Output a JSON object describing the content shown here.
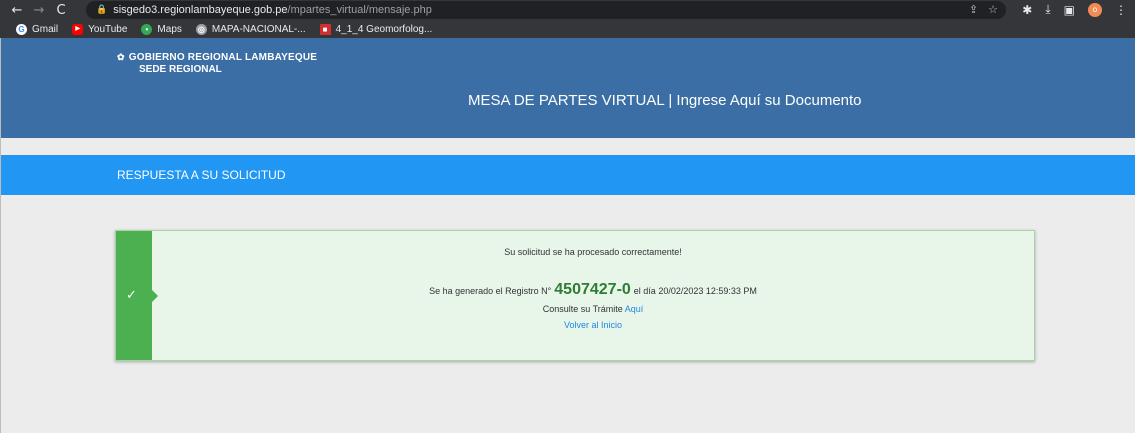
{
  "browser": {
    "url_host": "sisgedo3.regionlambayeque.gob.pe",
    "url_path": "/mpartes_virtual/mensaje.php",
    "profile_initial": "o",
    "bookmarks": [
      {
        "label": "Gmail"
      },
      {
        "label": "YouTube"
      },
      {
        "label": "Maps"
      },
      {
        "label": "MAPA-NACIONAL-..."
      },
      {
        "label": "4_1_4 Geomorfolog..."
      }
    ]
  },
  "header": {
    "org_name": "GOBIERNO REGIONAL LAMBAYEQUE",
    "org_sub": "SEDE REGIONAL",
    "title": "MESA DE PARTES VIRTUAL | Ingrese Aquí su Documento"
  },
  "section": {
    "title": "RESPUESTA A SU SOLICITUD"
  },
  "alert": {
    "success_msg": "Su solicitud se ha procesado correctamente!",
    "registro_prefix": "Se ha generado el Registro N°",
    "registro_num": "4507427-0",
    "registro_suffix": "el día 20/02/2023 12:59:33 PM",
    "consulte_text": "Consulte su Trámite",
    "aqui_link": "Aquí",
    "volver_link": "Volver al Inicio"
  },
  "colors": {
    "header_bg": "#3b6ea5",
    "bar_bg": "#2196f3",
    "success": "#4caf50"
  }
}
